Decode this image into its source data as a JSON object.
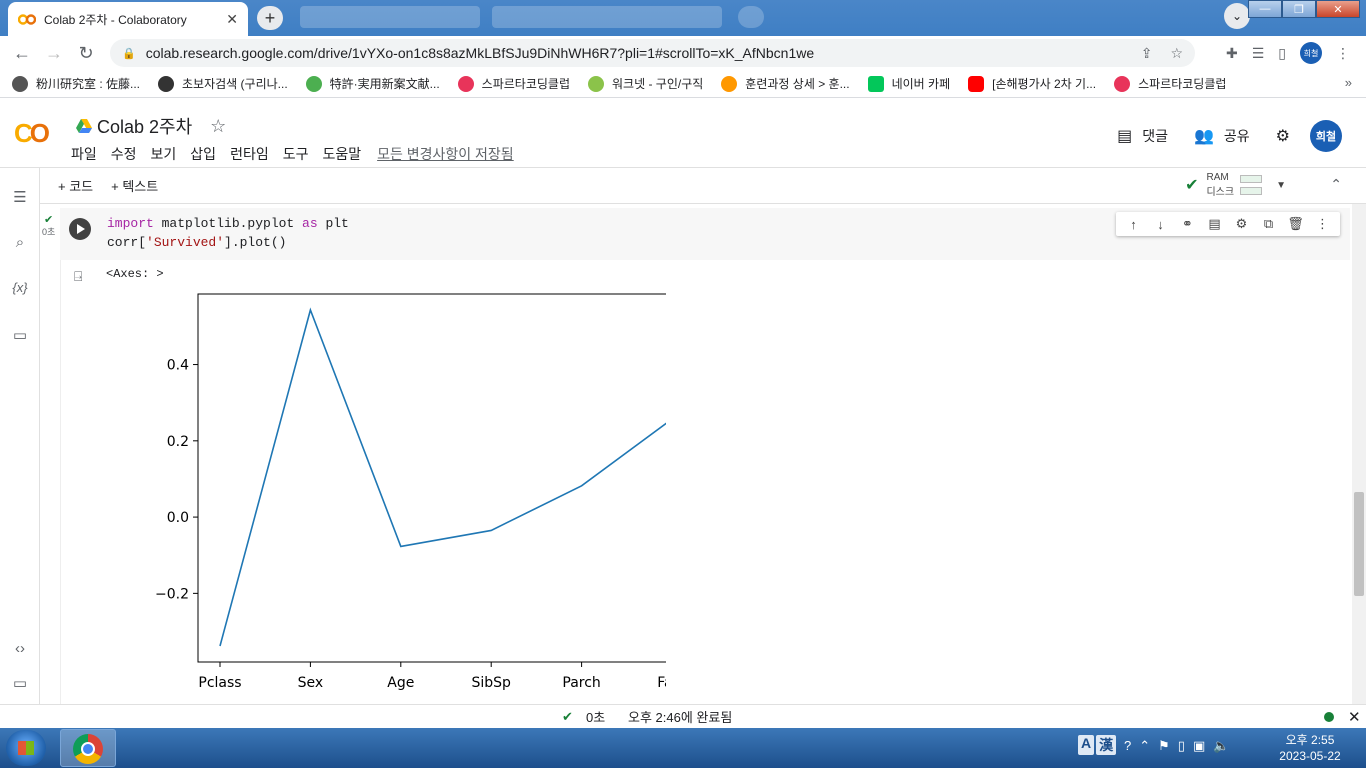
{
  "browser": {
    "active_tab_title": "Colab 2주차 - Colaboratory",
    "url": "colab.research.google.com/drive/1vYXo-on1c8s8azMkLBfSJu9DiNhWH6R7?pli=1#scrollTo=xK_AfNbcn1we",
    "profile_initials": "희철"
  },
  "bookmarks": [
    {
      "label": "粉川研究室 : 佐藤...",
      "color": "#555555"
    },
    {
      "label": "초보자검색 (구리나...",
      "color": "#333333"
    },
    {
      "label": "特許·実用新案文献...",
      "color": "#4caf50"
    },
    {
      "label": "스파르타코딩클럽",
      "color": "#e8345a"
    },
    {
      "label": "워크넷 - 구인/구직",
      "color": "#8bc34a"
    },
    {
      "label": "훈련과정 상세 > 훈...",
      "color": "#ff9800"
    },
    {
      "label": "네이버 카페",
      "color": "#03c75a"
    },
    {
      "label": "[손해평가사 2차 기...",
      "color": "#ff0000"
    },
    {
      "label": "스파르타코딩클럽",
      "color": "#e8345a"
    }
  ],
  "colab": {
    "notebook_title": "Colab 2주차",
    "menu": [
      "파일",
      "수정",
      "보기",
      "삽입",
      "런타임",
      "도구",
      "도움말"
    ],
    "saved_status": "모든 변경사항이 저장됨",
    "comments_label": "댓글",
    "share_label": "공유",
    "user_initials": "희철",
    "add_code_label": "+ 코드",
    "add_text_label": "+ 텍스트",
    "ram_label": "RAM",
    "disk_label": "디스크"
  },
  "cell": {
    "exec_time": "0초",
    "code_line1_kw1": "import",
    "code_line1_mod": " matplotlib.pyplot ",
    "code_line1_kw2": "as",
    "code_line1_alias": " plt",
    "code_line2_pre": "corr[",
    "code_line2_str": "'Survived'",
    "code_line2_post": "].plot()",
    "output_text": "<Axes: >"
  },
  "chart_data": {
    "type": "line",
    "categories": [
      "Pclass",
      "Sex",
      "Age",
      "SibSp",
      "Parch",
      "Fare"
    ],
    "values": [
      -0.338,
      0.543,
      -0.077,
      -0.035,
      0.082,
      0.257
    ],
    "yticks": [
      -0.2,
      0.0,
      0.2,
      0.4
    ],
    "ytick_labels": [
      "−0.2",
      "0.0",
      "0.2",
      "0.4"
    ],
    "ylim": [
      -0.38,
      0.585
    ],
    "color": "#1f77b4"
  },
  "status": {
    "elapsed": "0초",
    "message": "오후 2:46에 완료됨"
  },
  "taskbar": {
    "time": "오후 2:55",
    "date": "2023-05-22",
    "ime_a": "A",
    "ime_han": "漢"
  }
}
